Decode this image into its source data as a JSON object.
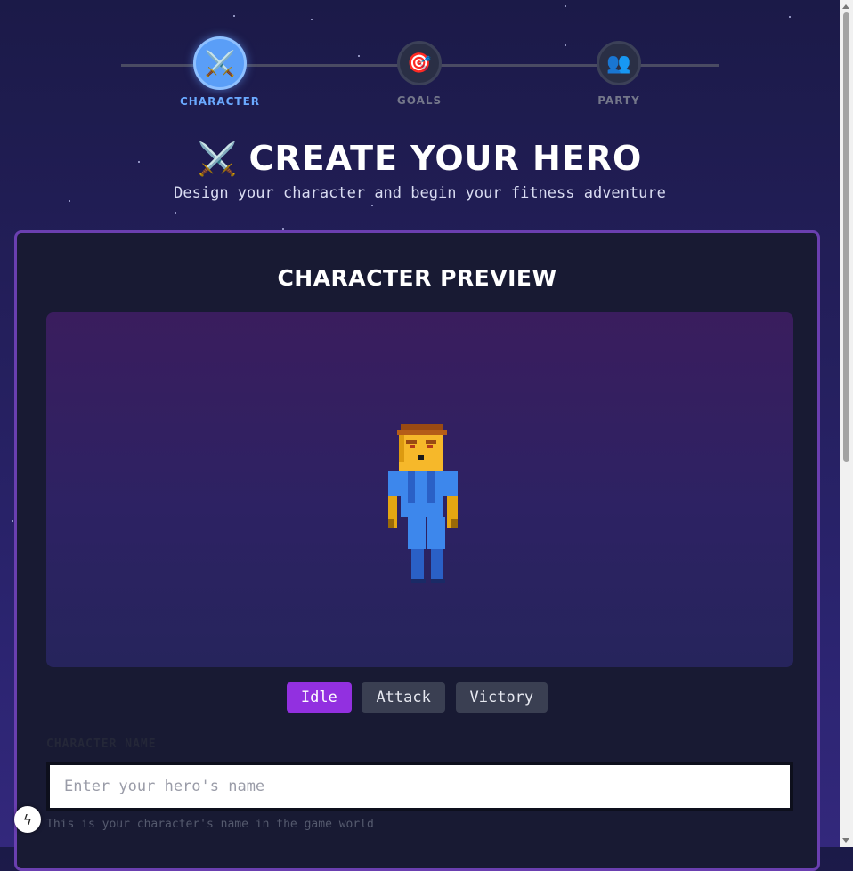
{
  "stepper": {
    "steps": [
      {
        "label": "CHARACTER",
        "icon": "⚔️"
      },
      {
        "label": "GOALS",
        "icon": "🎯"
      },
      {
        "label": "PARTY",
        "icon": "👥"
      }
    ]
  },
  "header": {
    "icon": "⚔️",
    "title": "CREATE YOUR HERO",
    "subtitle": "Design your character and begin your fitness adventure"
  },
  "card": {
    "title": "CHARACTER PREVIEW",
    "animations": [
      "Idle",
      "Attack",
      "Victory"
    ],
    "selected_animation": "Idle",
    "name_label": "CHARACTER NAME",
    "name_placeholder": "Enter your hero's name",
    "name_value": "",
    "name_helper": "This is your character's name in the game world"
  },
  "dev_badge": "ϟ",
  "colors": {
    "accent": "#9230e0",
    "step_active": "#5a9ef7",
    "card_border": "#6a3fb0"
  }
}
